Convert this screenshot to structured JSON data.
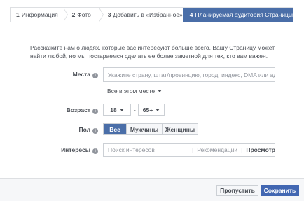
{
  "steps": [
    {
      "num": "1",
      "label": "Информация"
    },
    {
      "num": "2",
      "label": "Фото"
    },
    {
      "num": "3",
      "label": "Добавить в «Избранное»"
    },
    {
      "num": "4",
      "label": "Планируемая аудитория Страницы"
    }
  ],
  "intro": "Расскажите нам о людях, которые вас интересуют больше всего. Вашу Страницу может найти любой, но мы постараемся сделать ее более заметной для тех, кто вам важен.",
  "location": {
    "label": "Места",
    "placeholder": "Укажите страну, штат/провинцию, город, индекс, DMA или адр",
    "scope": "Все в этом месте"
  },
  "age": {
    "label": "Возраст",
    "min": "18",
    "separator": "-",
    "max": "65+"
  },
  "gender": {
    "label": "Пол",
    "options": [
      "Все",
      "Мужчины",
      "Женщины"
    ],
    "selected": "Все"
  },
  "interests": {
    "label": "Интересы",
    "placeholder": "Поиск интересов",
    "suggestions": "Рекомендации",
    "browse": "Просмотр"
  },
  "info_icon": "i",
  "footer": {
    "skip": "Пропустить",
    "save": "Сохранить"
  },
  "colors": {
    "accent": "#4a6ea8",
    "primary_button": "#4267b2"
  }
}
